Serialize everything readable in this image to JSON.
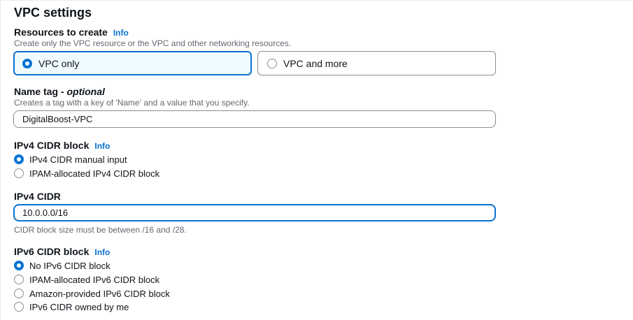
{
  "section": {
    "title": "VPC settings"
  },
  "resources": {
    "label": "Resources to create",
    "info": "Info",
    "description": "Create only the VPC resource or the VPC and other networking resources.",
    "options": [
      {
        "label": "VPC only",
        "selected": true
      },
      {
        "label": "VPC and more",
        "selected": false
      }
    ]
  },
  "name_tag": {
    "label": "Name tag - ",
    "label_optional": "optional",
    "description": "Creates a tag with a key of 'Name' and a value that you specify.",
    "value": "DigitalBoost-VPC"
  },
  "ipv4_block": {
    "label": "IPv4 CIDR block",
    "info": "Info",
    "options": [
      {
        "label": "IPv4 CIDR manual input",
        "selected": true
      },
      {
        "label": "IPAM-allocated IPv4 CIDR block",
        "selected": false
      }
    ]
  },
  "ipv4_cidr": {
    "label": "IPv4 CIDR",
    "value": "10.0.0.0/16",
    "hint": "CIDR block size must be between /16 and /28."
  },
  "ipv6_block": {
    "label": "IPv6 CIDR block",
    "info": "Info",
    "options": [
      {
        "label": "No IPv6 CIDR block",
        "selected": true
      },
      {
        "label": "IPAM-allocated IPv6 CIDR block",
        "selected": false
      },
      {
        "label": "Amazon-provided IPv6 CIDR block",
        "selected": false
      },
      {
        "label": "IPv6 CIDR owned by me",
        "selected": false
      }
    ]
  },
  "colors": {
    "accent": "#0972d3",
    "selected_bg": "#f0fbff",
    "border": "#8c8c94",
    "text": "#0f141a",
    "muted": "#656871"
  }
}
